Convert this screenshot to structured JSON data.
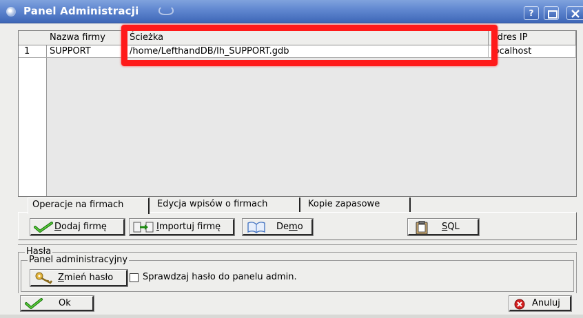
{
  "window": {
    "title": "Panel Administracji",
    "help_button": "?"
  },
  "table": {
    "columns": [
      "Nazwa firmy",
      "Ścieżka",
      "Adres IP"
    ],
    "rows": [
      {
        "num": "1",
        "name": "SUPPORT",
        "path": "/home/LefthandDB/lh_SUPPORT.gdb",
        "ip": "localhost"
      }
    ]
  },
  "highlight_color": "#ff1a1a",
  "tabs": [
    {
      "label": "Operacje na firmach",
      "active": true
    },
    {
      "label": "Edycja wpisów o firmach",
      "active": false
    },
    {
      "label": "Kopie zapasowe",
      "active": false
    }
  ],
  "actions": {
    "dodaj_hotkey": "D",
    "dodaj_rest": "odaj firmę",
    "importuj_hotkey": "I",
    "importuj_rest": "mportuj firmę",
    "demo_pre": "De",
    "demo_hotkey": "m",
    "demo_post": "o",
    "sql_hotkey": "S",
    "sql_rest": "QL"
  },
  "passwords": {
    "group_title": "Hasła",
    "subgroup_title": "Panel administracyjny",
    "change_hotkey": "Z",
    "change_rest": "mień hasło",
    "checkbox_label": "Sprawdzaj hasło do panelu admin.",
    "checkbox_checked": false
  },
  "footer": {
    "ok_label": "Ok",
    "cancel_label": "Anuluj"
  }
}
